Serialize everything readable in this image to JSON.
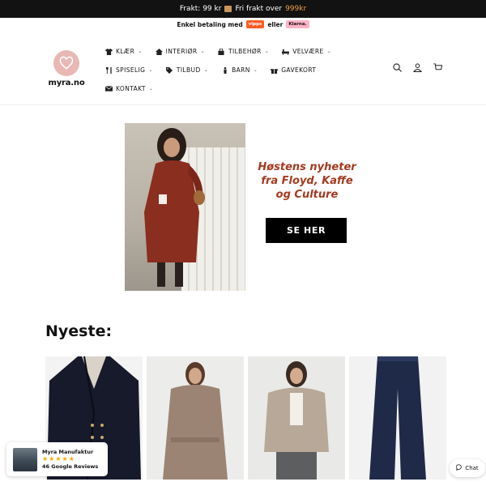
{
  "announcement": {
    "prefix": "Frakt: 99 kr",
    "middle": "Fri frakt over",
    "highlight": "999kr"
  },
  "payment": {
    "text": "Enkel betaling med",
    "vipps_label": "vipps",
    "or": "eller",
    "klarna_label": "Klarna."
  },
  "logo": {
    "text": "myra.no"
  },
  "nav": {
    "row1": [
      {
        "label": "KLÆR",
        "icon": "shirt-icon"
      },
      {
        "label": "INTERIØR",
        "icon": "home-icon"
      },
      {
        "label": "TILBEHØR",
        "icon": "bag-icon"
      },
      {
        "label": "VELVÆRE",
        "icon": "bath-icon"
      }
    ],
    "row2": [
      {
        "label": "SPISELIG",
        "icon": "cutlery-icon"
      },
      {
        "label": "TILBUD",
        "icon": "tag-icon"
      },
      {
        "label": "BARN",
        "icon": "child-icon"
      },
      {
        "label": "GAVEKORT",
        "icon": "gift-icon"
      }
    ],
    "row3": [
      {
        "label": "KONTAKT",
        "icon": "envelope-icon"
      }
    ]
  },
  "banner": {
    "line1": "Høstens nyheter",
    "line2": "fra Floyd, Kaffe",
    "line3": "og Culture",
    "cta": "SE HER"
  },
  "section": {
    "title": "Nyeste:"
  },
  "reviews": {
    "name": "Myra Manufaktur",
    "stars": "★★★★★",
    "count": "46 Google Reviews"
  },
  "chat": {
    "label": "Chat"
  },
  "colors": {
    "accent": "#f0a04b",
    "banner_text": "#a33a1f",
    "logo_pink": "#e8b8b5"
  }
}
